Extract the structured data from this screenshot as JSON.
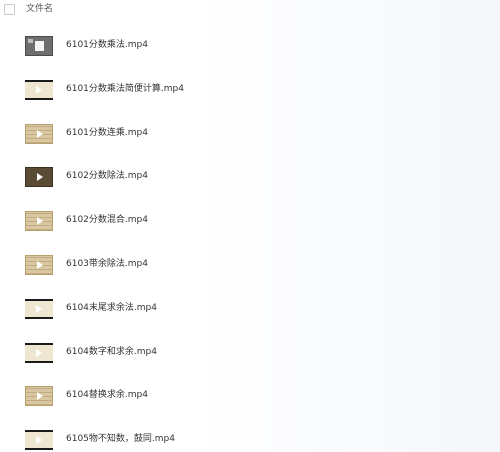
{
  "header": {
    "column_label": "文件名"
  },
  "files": [
    {
      "name": "6101分数乘法.mp4",
      "thumb_icon": "diagram-thumbnail"
    },
    {
      "name": "6101分数乘法简便计算.mp4",
      "thumb_icon": "video-play-thumbnail"
    },
    {
      "name": "6101分数连乘.mp4",
      "thumb_icon": "paper-play-thumbnail"
    },
    {
      "name": "6102分数除法.mp4",
      "thumb_icon": "dark-play-thumbnail"
    },
    {
      "name": "6102分数混合.mp4",
      "thumb_icon": "paper-play-thumbnail"
    },
    {
      "name": "6103带余除法.mp4",
      "thumb_icon": "paper-play-thumbnail"
    },
    {
      "name": "6104末尾求余法.mp4",
      "thumb_icon": "video-play-thumbnail"
    },
    {
      "name": "6104数字和求余.mp4",
      "thumb_icon": "video-play-thumbnail"
    },
    {
      "name": "6104替换求余.mp4",
      "thumb_icon": "paper-play-thumbnail"
    },
    {
      "name": "6105物不知数，鼓同.mp4",
      "thumb_icon": "video-play-thumbnail"
    }
  ]
}
